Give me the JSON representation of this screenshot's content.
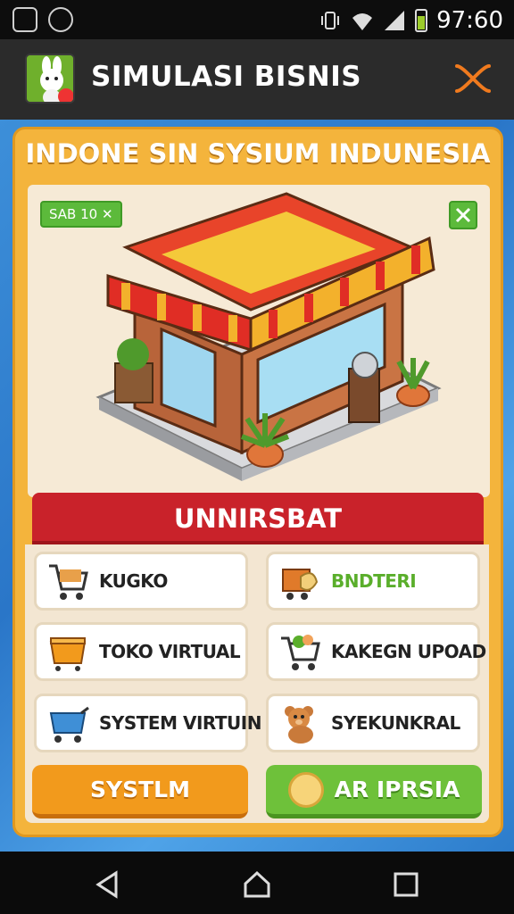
{
  "status_bar": {
    "time": "97:60",
    "icons": [
      "android-debug-icon",
      "speedometer-icon",
      "vibrate-icon",
      "wifi-icon",
      "signal-icon",
      "battery-icon"
    ],
    "battery_color": "#9ccc2b"
  },
  "app_bar": {
    "title": "SIMULASI BISNIS",
    "logo_icon": "app-logo-bunny-icon",
    "close_icon": "close-icon",
    "accent": "#f07a1e"
  },
  "panel": {
    "title": "INDONE SIN SYSIUM INDUNESIA",
    "level_badge": "SAΒ 10",
    "shop_image": "storefront-illustration"
  },
  "menu": {
    "header": "UNNIRSBAT",
    "items": [
      {
        "label": "KUGKO",
        "icon": "shopping-cart-icon",
        "highlight": false
      },
      {
        "label": "BNDTERI",
        "icon": "warehouse-cart-icon",
        "highlight": true
      },
      {
        "label": "TOKO VIRTUAL",
        "icon": "orange-crate-icon",
        "highlight": false
      },
      {
        "label": "KAKEGN UPOAD",
        "icon": "vegetable-cart-icon",
        "highlight": false
      },
      {
        "label": "SYSTEM VIRTUIN",
        "icon": "blue-cart-icon",
        "highlight": false
      },
      {
        "label": "SYEKUNKRAL",
        "icon": "bear-icon",
        "highlight": false
      }
    ]
  },
  "actions": {
    "left_button": "SYSTLM",
    "right_button": "AR IPRSIA"
  },
  "colors": {
    "panel": "#f4b43c",
    "banner": "#c9222a",
    "green": "#6ec13a",
    "orange": "#f29a1c",
    "background": "#2a76c8"
  }
}
